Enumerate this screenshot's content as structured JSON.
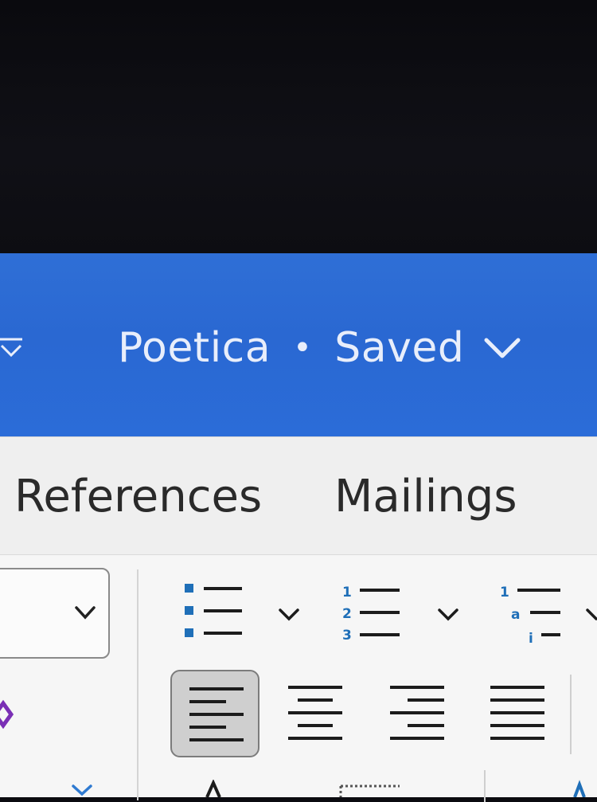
{
  "document": {
    "name": "Poetica",
    "separator": "•",
    "status": "Saved"
  },
  "ribbon_tabs": [
    {
      "label": "References"
    },
    {
      "label": "Mailings"
    }
  ],
  "colors": {
    "titlebar": "#2b6cd8",
    "accent_list": "#1f6fb8",
    "purple_mark": "#7a2fb5"
  },
  "icons": {
    "qat": "customize-qat-chevron-icon",
    "title_menu": "chevron-down-icon",
    "bullets": "bullet-list-icon",
    "numbering": "numbered-list-icon",
    "multilevel": "multilevel-list-icon",
    "align_left": "align-left-icon",
    "center": "align-center-icon",
    "align_right": "align-right-icon",
    "justify": "justify-icon"
  }
}
